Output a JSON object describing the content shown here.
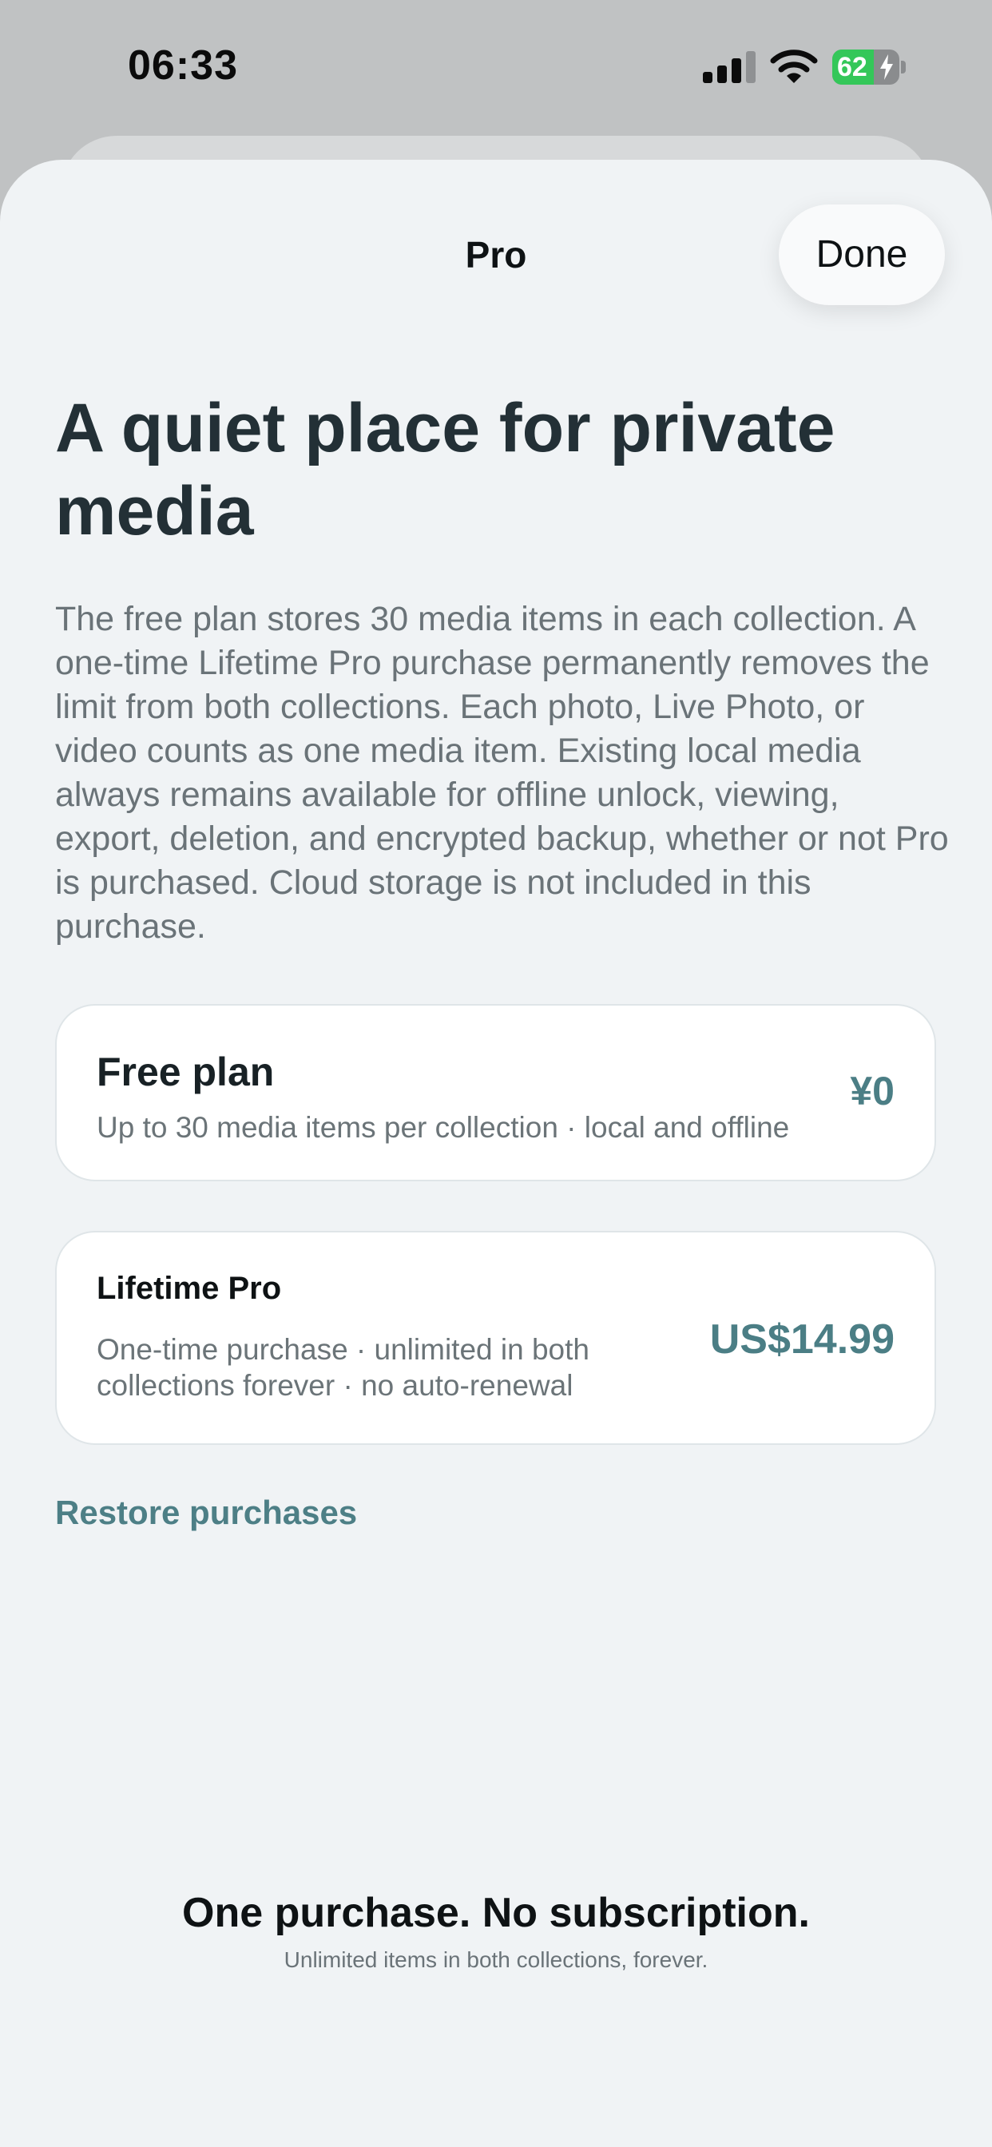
{
  "status_bar": {
    "time": "06:33",
    "battery_level": "62",
    "battery_fraction": 0.62,
    "battery_charging": true,
    "icons": [
      "cellular-signal-icon",
      "wifi-icon",
      "battery-icon",
      "charging-bolt-icon"
    ]
  },
  "nav": {
    "title": "Pro",
    "done_label": "Done"
  },
  "headline": "A quiet place for private media",
  "intro": "The free plan stores 30 media items in each collection. A one-time Lifetime Pro purchase permanently removes the limit from both collections. Each photo, Live Photo, or video counts as one media item. Existing local media always remains available for offline unlock, viewing, export, deletion, and encrypted backup, whether or not Pro is purchased. Cloud storage is not included in this purchase.",
  "plans": [
    {
      "name": "Free plan",
      "description": "Up to 30 media items per collection · local and offline",
      "price": "¥0"
    },
    {
      "name": "Lifetime Pro",
      "description": "One-time purchase · unlimited in both collections forever · no auto-renewal",
      "price": "US$14.99"
    }
  ],
  "restore_label": "Restore purchases",
  "footer": {
    "title": "One purchase. No subscription.",
    "subtitle": "Unlimited items in both collections, forever."
  },
  "colors": {
    "accent": "#4b7e85",
    "sheet_background": "#f0f3f5",
    "headline": "#233036",
    "battery_fill": "#34c759"
  }
}
